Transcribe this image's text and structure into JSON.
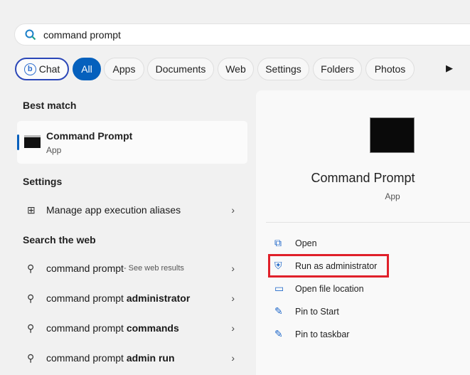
{
  "search": {
    "value": "command prompt",
    "icon": "search-icon"
  },
  "filters": [
    {
      "label": "Chat",
      "icon": "bing-icon"
    },
    {
      "label": "All"
    },
    {
      "label": "Apps"
    },
    {
      "label": "Documents"
    },
    {
      "label": "Web"
    },
    {
      "label": "Settings"
    },
    {
      "label": "Folders"
    },
    {
      "label": "Photos"
    }
  ],
  "best_match": {
    "header": "Best match",
    "title": "Command Prompt",
    "subtitle": "App"
  },
  "settings": {
    "header": "Settings",
    "items": [
      {
        "label": "Manage app execution aliases"
      }
    ]
  },
  "web": {
    "header": "Search the web",
    "items": [
      {
        "prefix": "command prompt",
        "bold": "",
        "suffix": " - See web results"
      },
      {
        "prefix": "command prompt ",
        "bold": "administrator",
        "suffix": ""
      },
      {
        "prefix": "command prompt ",
        "bold": "commands",
        "suffix": ""
      },
      {
        "prefix": "command prompt ",
        "bold": "admin run",
        "suffix": ""
      }
    ]
  },
  "detail": {
    "title": "Command Prompt",
    "subtitle": "App",
    "actions": [
      {
        "label": "Open",
        "icon": "open-external-icon"
      },
      {
        "label": "Run as administrator",
        "icon": "shield-app-icon",
        "highlighted": true
      },
      {
        "label": "Open file location",
        "icon": "folder-icon"
      },
      {
        "label": "Pin to Start",
        "icon": "pin-icon"
      },
      {
        "label": "Pin to taskbar",
        "icon": "pin-icon"
      }
    ]
  },
  "colors": {
    "accent": "#0560bd",
    "highlight": "#e0202a"
  }
}
